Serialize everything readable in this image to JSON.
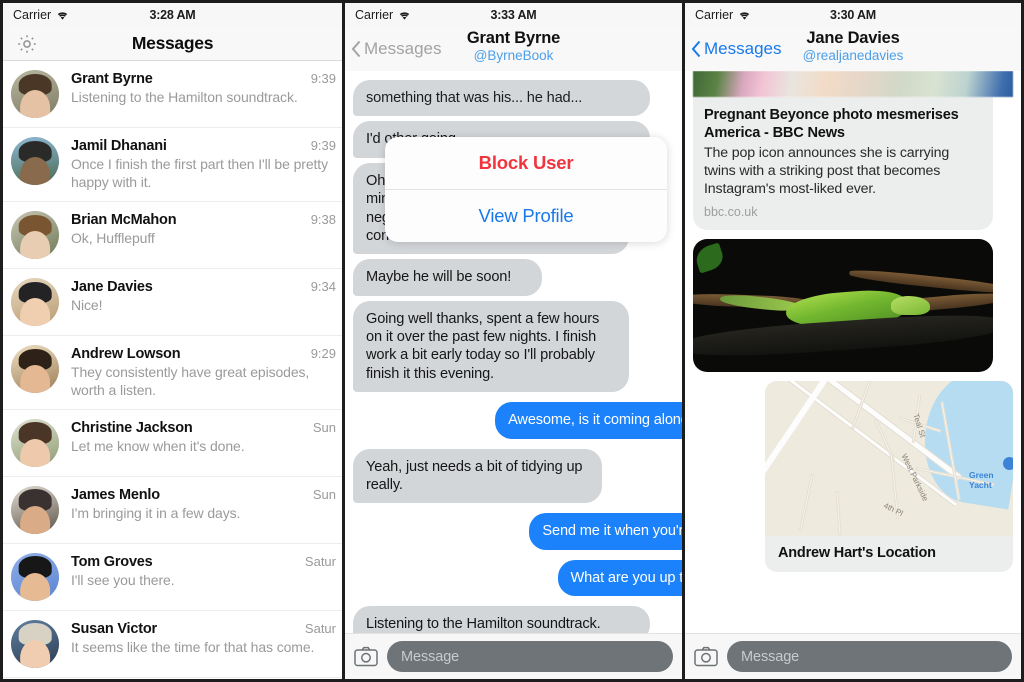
{
  "panels": {
    "inbox": {
      "status": {
        "carrier": "Carrier",
        "time": "3:28 AM",
        "wifi_icon": "wifi-icon"
      },
      "nav": {
        "title": "Messages",
        "settings_icon": "gear-icon"
      },
      "conversations": [
        {
          "name": "Grant Byrne",
          "preview": "Listening to the Hamilton soundtrack.",
          "time": "9:39"
        },
        {
          "name": "Jamil Dhanani",
          "preview": "Once I finish the first part then I'll be pretty happy with it.",
          "time": "9:39"
        },
        {
          "name": "Brian McMahon",
          "preview": "Ok, Hufflepuff",
          "time": "9:38"
        },
        {
          "name": "Jane Davies",
          "preview": "Nice!",
          "time": "9:34"
        },
        {
          "name": "Andrew Lowson",
          "preview": "They consistently have great episodes, worth a listen.",
          "time": "9:29"
        },
        {
          "name": "Christine Jackson",
          "preview": "Let me know when it's done.",
          "time": "Sun"
        },
        {
          "name": "James Menlo",
          "preview": "I'm bringing it in a few days.",
          "time": "Sun"
        },
        {
          "name": "Tom Groves",
          "preview": "I'll see you there.",
          "time": "Satur"
        },
        {
          "name": "Susan Victor",
          "preview": "It seems like the time for that has come.",
          "time": "Satur"
        }
      ]
    },
    "thread_grant": {
      "status": {
        "carrier": "Carrier",
        "time": "3:33 AM",
        "wifi_icon": "wifi-icon"
      },
      "nav": {
        "back_label": "Messages",
        "back_icon": "chevron-left-icon",
        "name": "Grant Byrne",
        "handle": "@ByrneBook"
      },
      "action_sheet": {
        "block_label": "Block User",
        "profile_label": "View Profile",
        "block_color": "#f0353e",
        "profile_color": "#1879ec"
      },
      "messages": [
        {
          "side": "in",
          "text": "something that was his... he had..."
        },
        {
          "side": "in",
          "text": "I'd other going"
        },
        {
          "side": "in",
          "text": "Oh, he did. Was more his fault than mine, but I didn't really hear anything negative. He didn't seem too concerned."
        },
        {
          "side": "in",
          "text": "Maybe he will be soon!"
        },
        {
          "side": "in",
          "text": "Going well thanks, spent a few hours on it over the past few nights. I finish work a bit early today so I'll probably finish it this evening."
        },
        {
          "side": "out",
          "text": "Awesome, is it coming along we"
        },
        {
          "side": "in",
          "text": "Yeah, just needs a bit of tidying up really."
        },
        {
          "side": "out",
          "text": "Send me it when you're do"
        },
        {
          "side": "out",
          "text": "What are you up to no"
        },
        {
          "side": "in",
          "text": "Listening to the Hamilton soundtrack."
        }
      ],
      "input": {
        "placeholder": "Message",
        "camera_icon": "camera-icon"
      }
    },
    "thread_jane": {
      "status": {
        "carrier": "Carrier",
        "time": "3:30 AM",
        "wifi_icon": "wifi-icon"
      },
      "nav": {
        "back_label": "Messages",
        "back_icon": "chevron-left-icon",
        "name": "Jane Davies",
        "handle": "@realjanedavies"
      },
      "link_card": {
        "title": "Pregnant Beyonce photo mesmerises America - BBC News",
        "description": "The pop icon announces she is carrying twins with a striking post that becomes Instagram's most-liked ever.",
        "source": "bbc.co.uk"
      },
      "photo": {
        "alt": "green-iguana-photo"
      },
      "map": {
        "caption": "Andrew Hart's Location",
        "labels": [
          "Teal St",
          "West Parkside",
          "4th Pl"
        ],
        "poi": "Green Yacht"
      },
      "input": {
        "placeholder": "Message",
        "camera_icon": "camera-icon"
      }
    }
  },
  "colors": {
    "bubble_in": "#d3d6d9",
    "bubble_out": "#1b82fb",
    "accent_blue": "#1879ec",
    "destructive_red": "#f0353e",
    "chrome": "#f8f8f8"
  }
}
